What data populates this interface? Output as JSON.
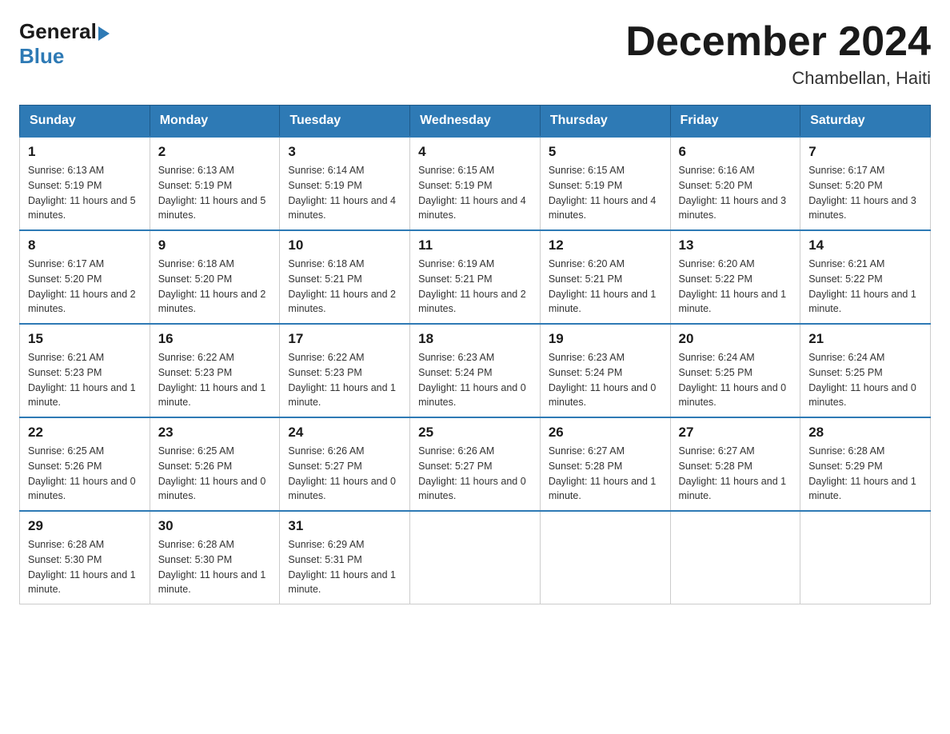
{
  "logo": {
    "general": "General",
    "blue": "Blue"
  },
  "title": "December 2024",
  "subtitle": "Chambellan, Haiti",
  "days_of_week": [
    "Sunday",
    "Monday",
    "Tuesday",
    "Wednesday",
    "Thursday",
    "Friday",
    "Saturday"
  ],
  "weeks": [
    [
      {
        "day": "1",
        "sunrise": "6:13 AM",
        "sunset": "5:19 PM",
        "daylight": "11 hours and 5 minutes."
      },
      {
        "day": "2",
        "sunrise": "6:13 AM",
        "sunset": "5:19 PM",
        "daylight": "11 hours and 5 minutes."
      },
      {
        "day": "3",
        "sunrise": "6:14 AM",
        "sunset": "5:19 PM",
        "daylight": "11 hours and 4 minutes."
      },
      {
        "day": "4",
        "sunrise": "6:15 AM",
        "sunset": "5:19 PM",
        "daylight": "11 hours and 4 minutes."
      },
      {
        "day": "5",
        "sunrise": "6:15 AM",
        "sunset": "5:19 PM",
        "daylight": "11 hours and 4 minutes."
      },
      {
        "day": "6",
        "sunrise": "6:16 AM",
        "sunset": "5:20 PM",
        "daylight": "11 hours and 3 minutes."
      },
      {
        "day": "7",
        "sunrise": "6:17 AM",
        "sunset": "5:20 PM",
        "daylight": "11 hours and 3 minutes."
      }
    ],
    [
      {
        "day": "8",
        "sunrise": "6:17 AM",
        "sunset": "5:20 PM",
        "daylight": "11 hours and 2 minutes."
      },
      {
        "day": "9",
        "sunrise": "6:18 AM",
        "sunset": "5:20 PM",
        "daylight": "11 hours and 2 minutes."
      },
      {
        "day": "10",
        "sunrise": "6:18 AM",
        "sunset": "5:21 PM",
        "daylight": "11 hours and 2 minutes."
      },
      {
        "day": "11",
        "sunrise": "6:19 AM",
        "sunset": "5:21 PM",
        "daylight": "11 hours and 2 minutes."
      },
      {
        "day": "12",
        "sunrise": "6:20 AM",
        "sunset": "5:21 PM",
        "daylight": "11 hours and 1 minute."
      },
      {
        "day": "13",
        "sunrise": "6:20 AM",
        "sunset": "5:22 PM",
        "daylight": "11 hours and 1 minute."
      },
      {
        "day": "14",
        "sunrise": "6:21 AM",
        "sunset": "5:22 PM",
        "daylight": "11 hours and 1 minute."
      }
    ],
    [
      {
        "day": "15",
        "sunrise": "6:21 AM",
        "sunset": "5:23 PM",
        "daylight": "11 hours and 1 minute."
      },
      {
        "day": "16",
        "sunrise": "6:22 AM",
        "sunset": "5:23 PM",
        "daylight": "11 hours and 1 minute."
      },
      {
        "day": "17",
        "sunrise": "6:22 AM",
        "sunset": "5:23 PM",
        "daylight": "11 hours and 1 minute."
      },
      {
        "day": "18",
        "sunrise": "6:23 AM",
        "sunset": "5:24 PM",
        "daylight": "11 hours and 0 minutes."
      },
      {
        "day": "19",
        "sunrise": "6:23 AM",
        "sunset": "5:24 PM",
        "daylight": "11 hours and 0 minutes."
      },
      {
        "day": "20",
        "sunrise": "6:24 AM",
        "sunset": "5:25 PM",
        "daylight": "11 hours and 0 minutes."
      },
      {
        "day": "21",
        "sunrise": "6:24 AM",
        "sunset": "5:25 PM",
        "daylight": "11 hours and 0 minutes."
      }
    ],
    [
      {
        "day": "22",
        "sunrise": "6:25 AM",
        "sunset": "5:26 PM",
        "daylight": "11 hours and 0 minutes."
      },
      {
        "day": "23",
        "sunrise": "6:25 AM",
        "sunset": "5:26 PM",
        "daylight": "11 hours and 0 minutes."
      },
      {
        "day": "24",
        "sunrise": "6:26 AM",
        "sunset": "5:27 PM",
        "daylight": "11 hours and 0 minutes."
      },
      {
        "day": "25",
        "sunrise": "6:26 AM",
        "sunset": "5:27 PM",
        "daylight": "11 hours and 0 minutes."
      },
      {
        "day": "26",
        "sunrise": "6:27 AM",
        "sunset": "5:28 PM",
        "daylight": "11 hours and 1 minute."
      },
      {
        "day": "27",
        "sunrise": "6:27 AM",
        "sunset": "5:28 PM",
        "daylight": "11 hours and 1 minute."
      },
      {
        "day": "28",
        "sunrise": "6:28 AM",
        "sunset": "5:29 PM",
        "daylight": "11 hours and 1 minute."
      }
    ],
    [
      {
        "day": "29",
        "sunrise": "6:28 AM",
        "sunset": "5:30 PM",
        "daylight": "11 hours and 1 minute."
      },
      {
        "day": "30",
        "sunrise": "6:28 AM",
        "sunset": "5:30 PM",
        "daylight": "11 hours and 1 minute."
      },
      {
        "day": "31",
        "sunrise": "6:29 AM",
        "sunset": "5:31 PM",
        "daylight": "11 hours and 1 minute."
      },
      null,
      null,
      null,
      null
    ]
  ],
  "labels": {
    "sunrise": "Sunrise:",
    "sunset": "Sunset:",
    "daylight": "Daylight:"
  }
}
